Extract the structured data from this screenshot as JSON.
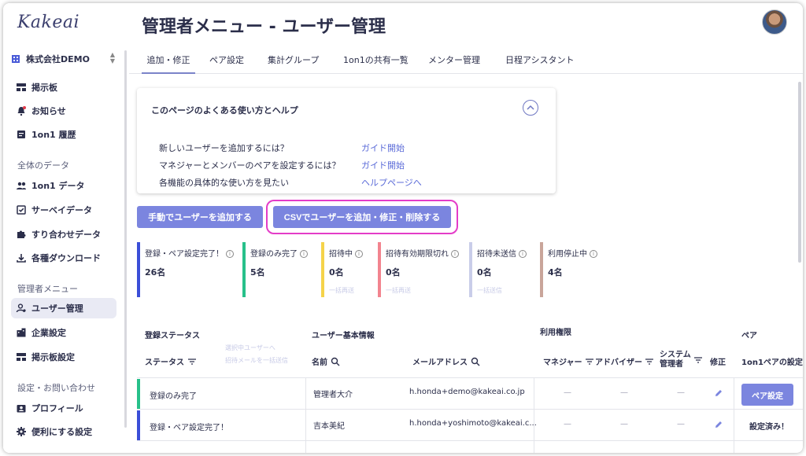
{
  "app": {
    "logo": "Kakeai"
  },
  "sidebar": {
    "company": "株式会社DEMO",
    "top_items": [
      {
        "label": "掲示板",
        "icon": "board-icon"
      },
      {
        "label": "お知らせ",
        "icon": "bell-icon"
      },
      {
        "label": "1on1 履歴",
        "icon": "history-icon"
      }
    ],
    "section_data": "全体のデータ",
    "data_items": [
      {
        "label": "1on1 データ",
        "icon": "people-icon"
      },
      {
        "label": "サーベイデータ",
        "icon": "survey-icon"
      },
      {
        "label": "すり合わせデータ",
        "icon": "puzzle-icon"
      },
      {
        "label": "各種ダウンロード",
        "icon": "download-icon"
      }
    ],
    "section_admin": "管理者メニュー",
    "admin_items": [
      {
        "label": "ユーザー管理",
        "icon": "user-manage-icon",
        "active": true
      },
      {
        "label": "企業設定",
        "icon": "company-icon"
      },
      {
        "label": "掲示板設定",
        "icon": "board-icon"
      }
    ],
    "section_settings": "設定・お問い合わせ",
    "settings_items": [
      {
        "label": "プロフィール",
        "icon": "profile-icon"
      },
      {
        "label": "便利にする設定",
        "icon": "gear-icon"
      }
    ]
  },
  "header": {
    "title": "管理者メニュー - ユーザー管理"
  },
  "tabs": [
    {
      "label": "追加・修正",
      "active": true
    },
    {
      "label": "ペア設定"
    },
    {
      "label": "集計グループ"
    },
    {
      "label": "1on1の共有一覧"
    },
    {
      "label": "メンター管理"
    },
    {
      "label": "日程アシスタント"
    }
  ],
  "help": {
    "title": "このページのよくある使い方とヘルプ",
    "rows": [
      {
        "q": "新しいユーザーを追加するには？",
        "link": "ガイド開始"
      },
      {
        "q": "マネジャーとメンバーのペアを設定するには？",
        "link": "ガイド開始"
      },
      {
        "q": "各機能の具体的な使い方を見たい",
        "link": "ヘルプページへ"
      }
    ]
  },
  "actions": {
    "add_manual": "手動でユーザーを追加する",
    "csv": "CSVでユーザーを追加・修正・削除する"
  },
  "stats": [
    {
      "label": "登録・ペア設定完了！",
      "value": "26名",
      "color": "#3b4ed8",
      "sub": ""
    },
    {
      "label": "登録のみ完了",
      "value": "5名",
      "color": "#27c08a",
      "sub": ""
    },
    {
      "label": "招待中",
      "value": "0名",
      "color": "#f5d34a",
      "sub": "一括再送"
    },
    {
      "label": "招待有効期限切れ",
      "value": "0名",
      "color": "#f2848f",
      "sub": "一括再送"
    },
    {
      "label": "招待未送信",
      "value": "0名",
      "color": "#c9cde9",
      "sub": "一括送信"
    },
    {
      "label": "利用停止中",
      "value": "4名",
      "color": "#c9a59a",
      "sub": ""
    }
  ],
  "table": {
    "groups": {
      "status": "登録ステータス",
      "basic": "ユーザー基本情報",
      "perm": "利用権限",
      "pair": "ペア"
    },
    "headers": {
      "status": "ステータス",
      "name": "名前",
      "email": "メールアドレス",
      "manager": "マネジャー",
      "advisor": "アドバイザー",
      "sysadmin_1": "システム",
      "sysadmin_2": "管理者",
      "edit": "修正",
      "pair_setting": "1on1ペアの設定"
    },
    "faint_links": [
      "選択中ユーザーへ",
      "招待メールを一括送信"
    ],
    "rows": [
      {
        "status": "登録のみ完了",
        "status_color": "#27c08a",
        "name": "管理者大介",
        "email": "h.honda+demo@kakeai.co.jp",
        "manager": "—",
        "advisor": "—",
        "sysadmin": "—",
        "pair": "ペア設定"
      },
      {
        "status": "登録・ペア設定完了！",
        "status_color": "#3b4ed8",
        "name": "吉本美紀",
        "email": "h.honda+yoshimoto@kakeai.c...",
        "manager": "—",
        "advisor": "—",
        "sysadmin": "—",
        "pair": "設定済み！"
      }
    ]
  }
}
